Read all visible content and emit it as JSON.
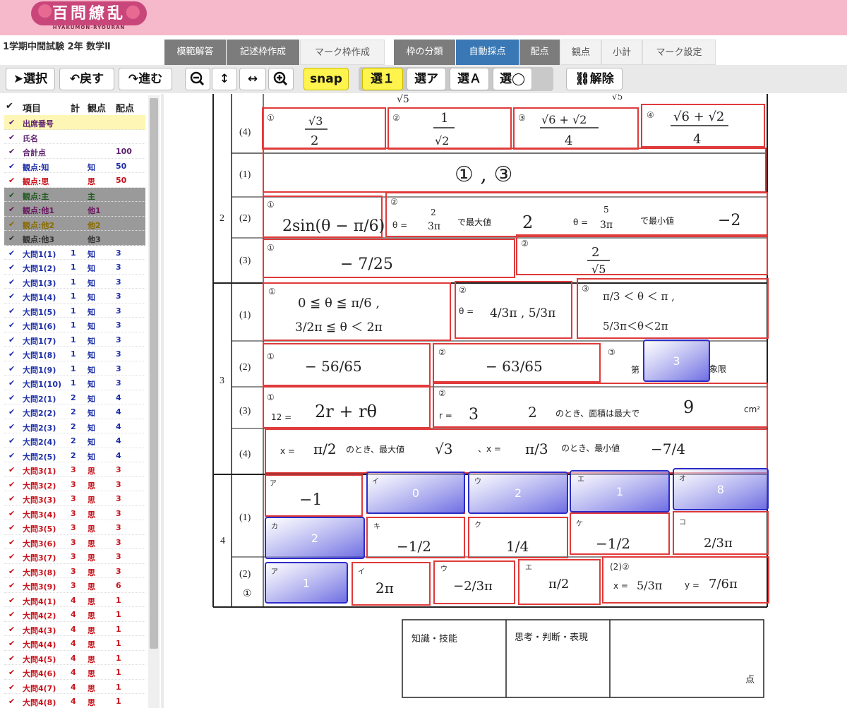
{
  "header": {
    "logo_text": "百問繚乱",
    "logo_sub": "HYAKUMON-RYOURAN",
    "exam_title": "1学期中間試験 2年 数学Ⅱ"
  },
  "tabs_left": [
    "模範解答",
    "記述枠作成",
    "マーク枠作成"
  ],
  "tabs_right": [
    "枠の分類",
    "自動採点",
    "配点",
    "観点",
    "小計",
    "マーク設定"
  ],
  "active_tab": "自動採点",
  "toolbar": {
    "select": "選択",
    "undo": "戻す",
    "redo": "進む",
    "snap": "snap",
    "sel1": "選１",
    "sel_a": "選ア",
    "sel_A": "選Ａ",
    "sel_o": "選◯",
    "unlink": "解除"
  },
  "side_panel": {
    "headers": {
      "item": "項目",
      "count": "計",
      "viewpoint": "観点",
      "points": "配点"
    },
    "rows": [
      {
        "name": "出席番号",
        "count": "",
        "vp": "",
        "pts": "",
        "style": "purple sel"
      },
      {
        "name": "氏名",
        "count": "",
        "vp": "",
        "pts": "",
        "style": "purple"
      },
      {
        "name": "合計点",
        "count": "",
        "vp": "",
        "pts": "100",
        "style": "purple"
      },
      {
        "name": "観点:知",
        "count": "",
        "vp": "知",
        "pts": "50",
        "style": "blue"
      },
      {
        "name": "観点:思",
        "count": "",
        "vp": "思",
        "pts": "50",
        "style": "red"
      },
      {
        "name": "観点:主",
        "count": "",
        "vp": "主",
        "pts": "",
        "style": "gray"
      },
      {
        "name": "観点:他1",
        "count": "",
        "vp": "他1",
        "pts": "",
        "style": "gray gray1"
      },
      {
        "name": "観点:他2",
        "count": "",
        "vp": "他2",
        "pts": "",
        "style": "gray gray2"
      },
      {
        "name": "観点:他3",
        "count": "",
        "vp": "他3",
        "pts": "",
        "style": "gray gray3"
      },
      {
        "name": "大問1(1)",
        "count": "1",
        "vp": "知",
        "pts": "3",
        "style": "blue"
      },
      {
        "name": "大問1(2)",
        "count": "1",
        "vp": "知",
        "pts": "3",
        "style": "blue"
      },
      {
        "name": "大問1(3)",
        "count": "1",
        "vp": "知",
        "pts": "3",
        "style": "blue"
      },
      {
        "name": "大問1(4)",
        "count": "1",
        "vp": "知",
        "pts": "3",
        "style": "blue"
      },
      {
        "name": "大問1(5)",
        "count": "1",
        "vp": "知",
        "pts": "3",
        "style": "blue"
      },
      {
        "name": "大問1(6)",
        "count": "1",
        "vp": "知",
        "pts": "3",
        "style": "blue"
      },
      {
        "name": "大問1(7)",
        "count": "1",
        "vp": "知",
        "pts": "3",
        "style": "blue"
      },
      {
        "name": "大問1(8)",
        "count": "1",
        "vp": "知",
        "pts": "3",
        "style": "blue"
      },
      {
        "name": "大問1(9)",
        "count": "1",
        "vp": "知",
        "pts": "3",
        "style": "blue"
      },
      {
        "name": "大問1(10)",
        "count": "1",
        "vp": "知",
        "pts": "3",
        "style": "blue"
      },
      {
        "name": "大問2(1)",
        "count": "2",
        "vp": "知",
        "pts": "4",
        "style": "blue"
      },
      {
        "name": "大問2(2)",
        "count": "2",
        "vp": "知",
        "pts": "4",
        "style": "blue"
      },
      {
        "name": "大問2(3)",
        "count": "2",
        "vp": "知",
        "pts": "4",
        "style": "blue"
      },
      {
        "name": "大問2(4)",
        "count": "2",
        "vp": "知",
        "pts": "4",
        "style": "blue"
      },
      {
        "name": "大問2(5)",
        "count": "2",
        "vp": "知",
        "pts": "4",
        "style": "blue"
      },
      {
        "name": "大問3(1)",
        "count": "3",
        "vp": "思",
        "pts": "3",
        "style": "red"
      },
      {
        "name": "大問3(2)",
        "count": "3",
        "vp": "思",
        "pts": "3",
        "style": "red"
      },
      {
        "name": "大問3(3)",
        "count": "3",
        "vp": "思",
        "pts": "3",
        "style": "red"
      },
      {
        "name": "大問3(4)",
        "count": "3",
        "vp": "思",
        "pts": "3",
        "style": "red"
      },
      {
        "name": "大問3(5)",
        "count": "3",
        "vp": "思",
        "pts": "3",
        "style": "red"
      },
      {
        "name": "大問3(6)",
        "count": "3",
        "vp": "思",
        "pts": "3",
        "style": "red"
      },
      {
        "name": "大問3(7)",
        "count": "3",
        "vp": "思",
        "pts": "3",
        "style": "red"
      },
      {
        "name": "大問3(8)",
        "count": "3",
        "vp": "思",
        "pts": "3",
        "style": "red"
      },
      {
        "name": "大問3(9)",
        "count": "3",
        "vp": "思",
        "pts": "6",
        "style": "red"
      },
      {
        "name": "大問4(1)",
        "count": "4",
        "vp": "思",
        "pts": "1",
        "style": "red"
      },
      {
        "name": "大問4(2)",
        "count": "4",
        "vp": "思",
        "pts": "1",
        "style": "red"
      },
      {
        "name": "大問4(3)",
        "count": "4",
        "vp": "思",
        "pts": "1",
        "style": "red"
      },
      {
        "name": "大問4(4)",
        "count": "4",
        "vp": "思",
        "pts": "1",
        "style": "red"
      },
      {
        "name": "大問4(5)",
        "count": "4",
        "vp": "思",
        "pts": "1",
        "style": "red"
      },
      {
        "name": "大問4(6)",
        "count": "4",
        "vp": "思",
        "pts": "1",
        "style": "red"
      },
      {
        "name": "大問4(7)",
        "count": "4",
        "vp": "思",
        "pts": "1",
        "style": "red"
      },
      {
        "name": "大問4(8)",
        "count": "4",
        "vp": "思",
        "pts": "1",
        "style": "red"
      }
    ]
  },
  "sheet": {
    "sections": [
      "2",
      "3",
      "4"
    ],
    "subq_labels": [
      "(4)",
      "(1)",
      "(2)",
      "(3)",
      "(1)",
      "(2)",
      "(3)",
      "(4)",
      "(1)",
      "(2)",
      "①"
    ],
    "q2_2_text": {
      "theta": "θ =",
      "max": "で最大値",
      "min": "で最小値"
    },
    "q3_2_text": {
      "prefix": "第",
      "suffix": "象限"
    },
    "q3_3_text": {
      "area": "12 =",
      "r": "r =",
      "when": "のとき、面積は最大で",
      "unit": "cm²"
    },
    "q3_4_text": {
      "x": "x =",
      "max": "のとき、最大値",
      "x2": "、x =",
      "min": "のとき、最小値"
    },
    "q4_2_text": {
      "x": "x =",
      "y": "y ="
    },
    "blue_marks": [
      {
        "label": "3",
        "cell": "3-2-3"
      },
      {
        "label": "0",
        "cell": "4-1-イ"
      },
      {
        "label": "2",
        "cell": "4-1-ウ"
      },
      {
        "label": "1",
        "cell": "4-1-エ"
      },
      {
        "label": "8",
        "cell": "4-1-オ"
      },
      {
        "label": "2",
        "cell": "4-1-カ"
      },
      {
        "label": "1",
        "cell": "4-2-ア"
      }
    ],
    "score_table": {
      "col1": "知識・技能",
      "col2": "思考・判断・表現",
      "unit": "点"
    }
  }
}
